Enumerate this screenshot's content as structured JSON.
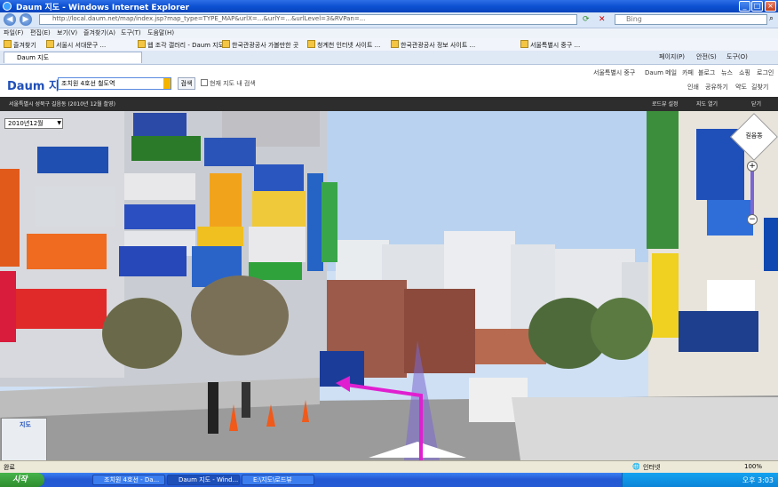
{
  "window": {
    "title": "Daum 지도 - Windows Internet Explorer",
    "address": "http://local.daum.net/map/index.jsp?map_type=TYPE_MAP&urlX=...&urlY=...&urlLevel=3&RVPan=...",
    "search_placeholder": "Bing"
  },
  "menu": [
    "파일(F)",
    "편집(E)",
    "보기(V)",
    "즐겨찾기(A)",
    "도구(T)",
    "도움말(H)"
  ],
  "favorites": [
    "즐겨찾기",
    "서울시 서대문구 ...",
    "웹 조각 갤러리 - Daum 지도",
    "한국관광공사 가볼만한 곳",
    "청계천 인터넷 사이트 ...",
    "한국관광공사 정보 사이트 ...",
    "서울특별시 중구 ..."
  ],
  "tab": {
    "label": "Daum 지도"
  },
  "tab_tools": [
    "페이지(P)",
    "안전(S)",
    "도구(O)"
  ],
  "daum": {
    "logo": "Daum 지도",
    "search_value": "조치원 4호선 철도역",
    "search_button": "검색",
    "checkbox_label": "현재 지도 내 검색",
    "top_links": [
      "서울특별시 중구",
      "Daum 메일",
      "카페",
      "블로그",
      "뉴스",
      "쇼핑",
      "로그인"
    ],
    "sub_links": [
      "인쇄",
      "공유하기",
      "약도",
      "길찾기"
    ]
  },
  "roadview": {
    "strip_left": "서울특별시 성북구 길음동 (2010년 12월 촬영)",
    "strip_right": [
      "로드뷰 설정",
      "지도 열기",
      "닫기"
    ],
    "date_selector": "2010년12월",
    "compass_label": "길음동",
    "zoom_in": "+",
    "zoom_out": "−",
    "minimap_label": "지도"
  },
  "status": {
    "left": "완료",
    "zone": "인터넷",
    "zoom": "100%"
  },
  "taskbar": {
    "start": "시작",
    "tasks": [
      "조치원 4호선 - Da...",
      "Daum 지도 - Wind...",
      "E:\\지도\\로드뷰"
    ],
    "clock": "오후 3:03"
  },
  "colors": {
    "title_bar": "#0b4fd0",
    "taskbar": "#245ad4",
    "accent_arrow": "#e020d0",
    "zoom_track": "#7b67d1"
  }
}
